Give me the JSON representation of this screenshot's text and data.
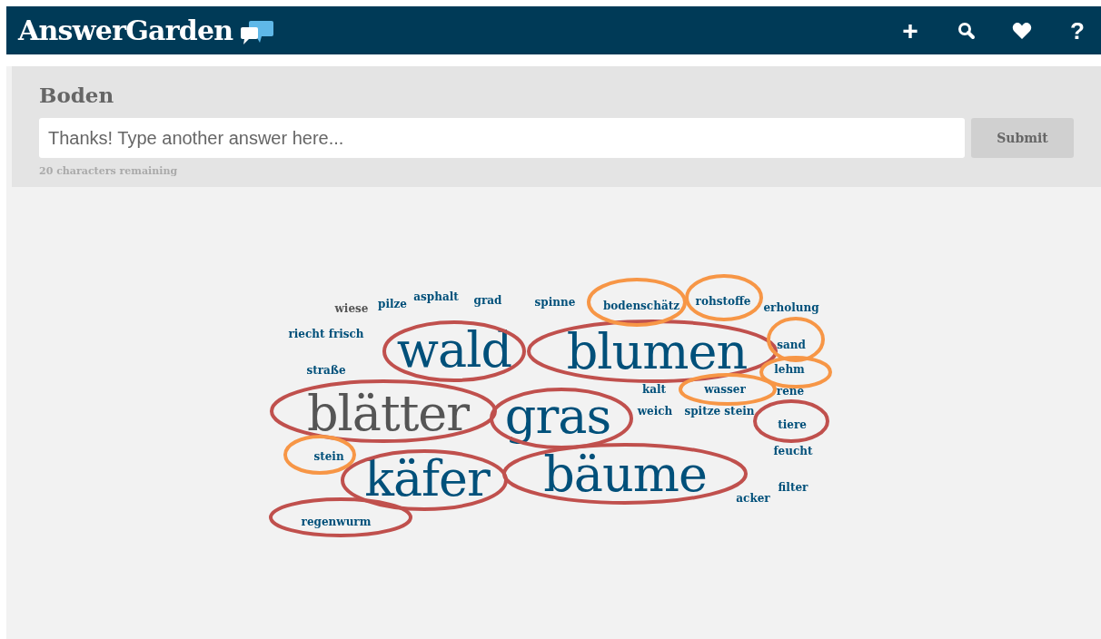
{
  "header": {
    "logo": "AnswerGarden",
    "actions": [
      "+",
      "?"
    ]
  },
  "garden": {
    "title": "Boden",
    "input": {
      "placeholder": "Thanks! Type another answer here..."
    },
    "submit": "Submit",
    "counter": "20 characters remaining"
  },
  "words": [
    {
      "text": "wiese",
      "color": "#555555"
    },
    {
      "text": "pilze",
      "color": "#00507a"
    },
    {
      "text": "asphalt",
      "color": "#00507a"
    },
    {
      "text": "grad",
      "color": "#00507a"
    },
    {
      "text": "spinne",
      "color": "#00507a"
    },
    {
      "text": "bodenschätz",
      "color": "#00507a"
    },
    {
      "text": "rohstoffe",
      "color": "#00507a"
    },
    {
      "text": "erholung",
      "color": "#00507a"
    },
    {
      "text": "riecht frisch",
      "color": "#00507a"
    },
    {
      "text": "wald",
      "color": "#00507a"
    },
    {
      "text": "blumen",
      "color": "#00507a"
    },
    {
      "text": "sand",
      "color": "#00507a"
    },
    {
      "text": "straße",
      "color": "#00507a"
    },
    {
      "text": "lehm",
      "color": "#00507a"
    },
    {
      "text": "blätter",
      "color": "#555555"
    },
    {
      "text": "gras",
      "color": "#00507a"
    },
    {
      "text": "kalt",
      "color": "#00507a"
    },
    {
      "text": "wasser",
      "color": "#00507a"
    },
    {
      "text": "rene",
      "color": "#00507a"
    },
    {
      "text": "weich",
      "color": "#00507a"
    },
    {
      "text": "spitze stein",
      "color": "#00507a"
    },
    {
      "text": "tiere",
      "color": "#00507a"
    },
    {
      "text": "feucht",
      "color": "#00507a"
    },
    {
      "text": "stein",
      "color": "#00507a"
    },
    {
      "text": "käfer",
      "color": "#00507a"
    },
    {
      "text": "bäume",
      "color": "#00507a"
    },
    {
      "text": "filter",
      "color": "#00507a"
    },
    {
      "text": "acker",
      "color": "#00507a"
    },
    {
      "text": "regenwurm",
      "color": "#00507a"
    }
  ],
  "annotations": [
    {
      "color": "#c0504d"
    },
    {
      "color": "#c0504d"
    },
    {
      "color": "#c0504d"
    },
    {
      "color": "#c0504d"
    },
    {
      "color": "#c0504d"
    },
    {
      "color": "#c0504d"
    },
    {
      "color": "#c0504d"
    },
    {
      "color": "#c0504d"
    },
    {
      "color": "#f79646"
    },
    {
      "color": "#f79646"
    },
    {
      "color": "#f79646"
    },
    {
      "color": "#f79646"
    },
    {
      "color": "#f79646"
    },
    {
      "color": "#f79646"
    }
  ]
}
